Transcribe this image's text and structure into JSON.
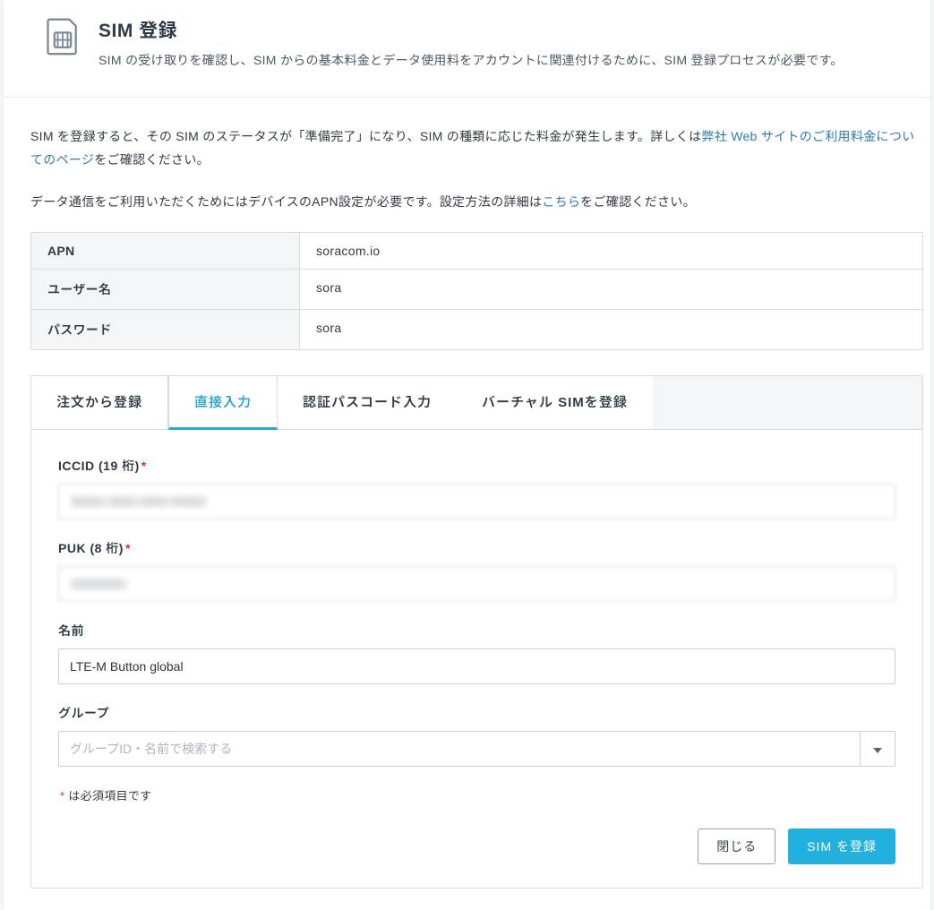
{
  "header": {
    "title": "SIM 登録",
    "subtitle": "SIM の受け取りを確認し、SIM からの基本料金とデータ使用料をアカウントに関連付けるために、SIM 登録プロセスが必要です。"
  },
  "info": {
    "p1_pre": "SIM を登録すると、その SIM のステータスが「準備完了」になり、SIM の種類に応じた料金が発生します。詳しくは",
    "p1_link": "弊社 Web サイトのご利用料金についてのページ",
    "p1_post": "をご確認ください。",
    "p2_pre": "データ通信をご利用いただくためにはデバイスのAPN設定が必要です。設定方法の詳細は",
    "p2_link": "こちら",
    "p2_post": "をご確認ください。"
  },
  "apn_table": {
    "rows": [
      {
        "key": "APN",
        "val": "soracom.io"
      },
      {
        "key": "ユーザー名",
        "val": "sora"
      },
      {
        "key": "パスワード",
        "val": "sora"
      }
    ]
  },
  "tabs": {
    "items": [
      {
        "label": "注文から登録",
        "active": false
      },
      {
        "label": "直接入力",
        "active": true
      },
      {
        "label": "認証パスコード入力",
        "active": false
      },
      {
        "label": "バーチャル SIMを登録",
        "active": false
      }
    ]
  },
  "form": {
    "iccid_label": "ICCID (19 桁)",
    "iccid_value": "00000 0000 0000 00000",
    "puk_label": "PUK (8 桁)",
    "puk_value": "00000000",
    "name_label": "名前",
    "name_value": "LTE-M Button global",
    "group_label": "グループ",
    "group_placeholder": "グループID・名前で検索する",
    "required_note": "は必須項目です"
  },
  "footer": {
    "close": "閉じる",
    "submit": "SIM を登録"
  }
}
